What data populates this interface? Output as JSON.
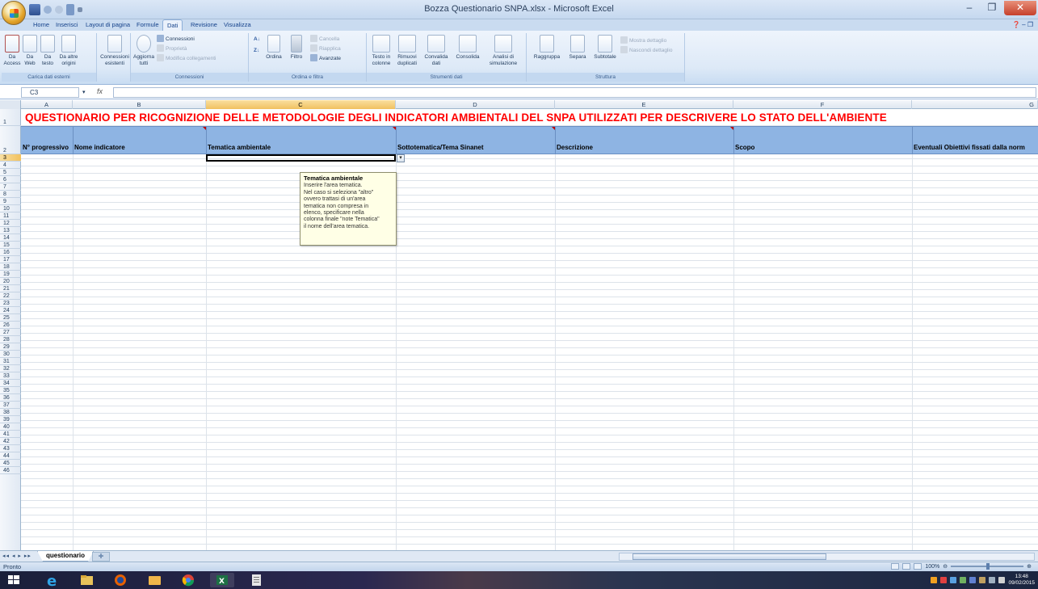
{
  "window": {
    "title": "Bozza Questionario SNPA.xlsx - Microsoft Excel"
  },
  "window_controls": {
    "minimize": "–",
    "restore": "❐",
    "close": "✕"
  },
  "tabs": [
    "Home",
    "Inserisci",
    "Layout di pagina",
    "Formule",
    "Dati",
    "Revisione",
    "Visualizza"
  ],
  "active_tab": "Dati",
  "ribbon": {
    "groups": {
      "external": "Carica dati esterni",
      "connections": "Connessioni",
      "sort": "Ordina e filtra",
      "tools": "Strumenti dati",
      "outline": "Struttura"
    },
    "buttons": {
      "access": "Da\nAccess",
      "web": "Da\nWeb",
      "text": "Da\ntesto",
      "other": "Da altre\norigini",
      "existing": "Connessioni\nesistenti",
      "refresh": "Aggiorna\ntutti",
      "conn": "Connessioni",
      "props": "Proprietà",
      "edit_links": "Modifica collegamenti",
      "sort": "Ordina",
      "filter": "Filtro",
      "clear": "Cancella",
      "reapply": "Riapplica",
      "advanced": "Avanzate",
      "text_cols": "Testo in\ncolonne",
      "remove_dup": "Rimuovi\nduplicati",
      "validate": "Convalida\ndati",
      "consolidate": "Consolida",
      "whatif": "Analisi di\nsimulazione",
      "group": "Raggruppa",
      "ungroup": "Separa",
      "subtotal": "Subtotale",
      "show_detail": "Mostra dettaglio",
      "hide_detail": "Nascondi dettaglio"
    }
  },
  "formula_bar": {
    "name_box": "C3",
    "fx": "fx",
    "value": ""
  },
  "columns": [
    "A",
    "B",
    "C",
    "D",
    "E",
    "F",
    "G"
  ],
  "row_numbers": [
    "1",
    "2",
    "3",
    "4",
    "5",
    "6",
    "7",
    "8",
    "9",
    "10",
    "11",
    "12",
    "13",
    "14",
    "15",
    "16",
    "17",
    "18",
    "19",
    "20",
    "21",
    "22",
    "23",
    "24",
    "25",
    "26",
    "27",
    "28",
    "29",
    "30",
    "31",
    "32",
    "33",
    "34",
    "35",
    "36",
    "37",
    "38",
    "39",
    "40",
    "41",
    "42",
    "43",
    "44",
    "45",
    "46"
  ],
  "sheet": {
    "title": "QUESTIONARIO PER RICOGNIZIONE DELLE METODOLOGIE DEGLI INDICATORI AMBIENTALI DEL SNPA UTILIZZATI PER DESCRIVERE LO STATO DELL'AMBIENTE",
    "headers": [
      "N° progressivo",
      "Nome indicatore",
      "Tematica ambientale",
      "Sottotematica/Tema Sinanet",
      "Descrizione",
      "Scopo",
      "Eventuali Obiettivi fissati dalla norm"
    ]
  },
  "tooltip": {
    "title": "Tematica ambientale",
    "lines": [
      "Inserire l'area tematica.",
      "Nel caso si seleziona \"altro\"",
      "ovvero trattasi di un'area",
      "tematica non compresa in",
      "elenco, specificare nella",
      "colonna finale \"note Tematica\"",
      "il nome dell'area tematica."
    ]
  },
  "sheet_tabs": [
    "questionario"
  ],
  "status": {
    "ready": "Pronto",
    "zoom": "100%"
  },
  "clock": {
    "time": "13:48",
    "date": "09/02/2015"
  }
}
